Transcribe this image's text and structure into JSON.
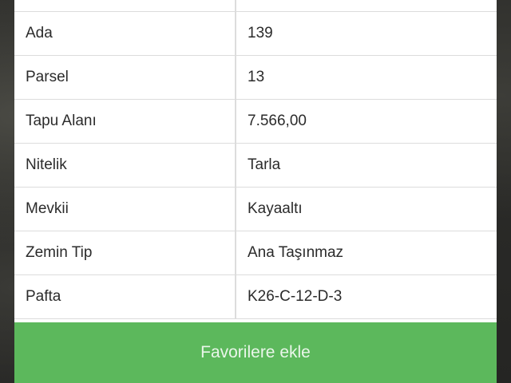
{
  "details": {
    "rows": [
      {
        "label": "",
        "value": ""
      },
      {
        "label": "Ada",
        "value": "139"
      },
      {
        "label": "Parsel",
        "value": "13"
      },
      {
        "label": "Tapu Alanı",
        "value": "7.566,00"
      },
      {
        "label": "Nitelik",
        "value": "Tarla"
      },
      {
        "label": "Mevkii",
        "value": "Kayaaltı"
      },
      {
        "label": "Zemin Tip",
        "value": "Ana Taşınmaz"
      },
      {
        "label": "Pafta",
        "value": "K26-C-12-D-3"
      }
    ]
  },
  "actions": {
    "favorite_label": "Favorilere ekle"
  },
  "colors": {
    "accent_green": "#5cb85c",
    "border": "#dcdcdc",
    "background_dark": "#2d2d2b"
  }
}
